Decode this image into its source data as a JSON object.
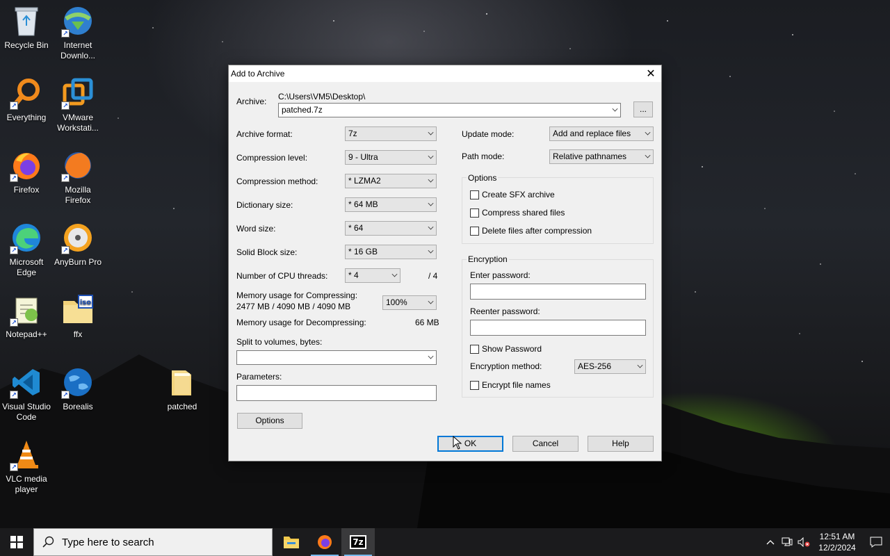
{
  "desktop": {
    "icons": [
      {
        "label": "Recycle Bin"
      },
      {
        "label": "Internet Downlo..."
      },
      {
        "label": "Everything"
      },
      {
        "label": "VMware Workstati..."
      },
      {
        "label": "Firefox"
      },
      {
        "label": "Mozilla Firefox"
      },
      {
        "label": "Microsoft Edge"
      },
      {
        "label": "AnyBurn Pro"
      },
      {
        "label": "Notepad++"
      },
      {
        "label": "ffx"
      },
      {
        "label": "Visual Studio Code"
      },
      {
        "label": "Borealis"
      },
      {
        "label": "VLC media player"
      },
      {
        "label": "patched"
      }
    ],
    "iso_badge": "iso"
  },
  "dialog": {
    "title": "Add to Archive",
    "archive_label": "Archive:",
    "archive_path": "C:\\Users\\VM5\\Desktop\\",
    "archive_name": "patched.7z",
    "browse_label": "...",
    "archive_format_label": "Archive format:",
    "archive_format": "7z",
    "compression_level_label": "Compression level:",
    "compression_level": "9 - Ultra",
    "compression_method_label": "Compression method:",
    "compression_method": "*  LZMA2",
    "dictionary_size_label": "Dictionary size:",
    "dictionary_size": "*  64 MB",
    "word_size_label": "Word size:",
    "word_size": "*  64",
    "solid_block_label": "Solid Block size:",
    "solid_block": "*  16 GB",
    "cpu_threads_label": "Number of CPU threads:",
    "cpu_threads": "*  4",
    "cpu_threads_total": "/ 4",
    "mem_compress_label": "Memory usage for Compressing:",
    "mem_compress_value": "2477 MB / 4090 MB / 4090 MB",
    "mem_percent": "100%",
    "mem_decompress_label": "Memory usage for Decompressing:",
    "mem_decompress_value": "66 MB",
    "split_label": "Split to volumes, bytes:",
    "split_value": "",
    "parameters_label": "Parameters:",
    "parameters_value": "",
    "options_button": "Options",
    "update_mode_label": "Update mode:",
    "update_mode": "Add and replace files",
    "path_mode_label": "Path mode:",
    "path_mode": "Relative pathnames",
    "options_group": "Options",
    "create_sfx": "Create SFX archive",
    "compress_shared": "Compress shared files",
    "delete_after": "Delete files after compression",
    "encryption_group": "Encryption",
    "enter_password_label": "Enter password:",
    "reenter_password_label": "Reenter password:",
    "show_password": "Show Password",
    "encryption_method_label": "Encryption method:",
    "encryption_method": "AES-256",
    "encrypt_names": "Encrypt file names",
    "ok": "OK",
    "cancel": "Cancel",
    "help": "Help",
    "close_glyph": "✕"
  },
  "taskbar": {
    "search_placeholder": "Type here to search",
    "app_7z": "7z",
    "time": "12:51 AM",
    "date": "12/2/2024"
  }
}
